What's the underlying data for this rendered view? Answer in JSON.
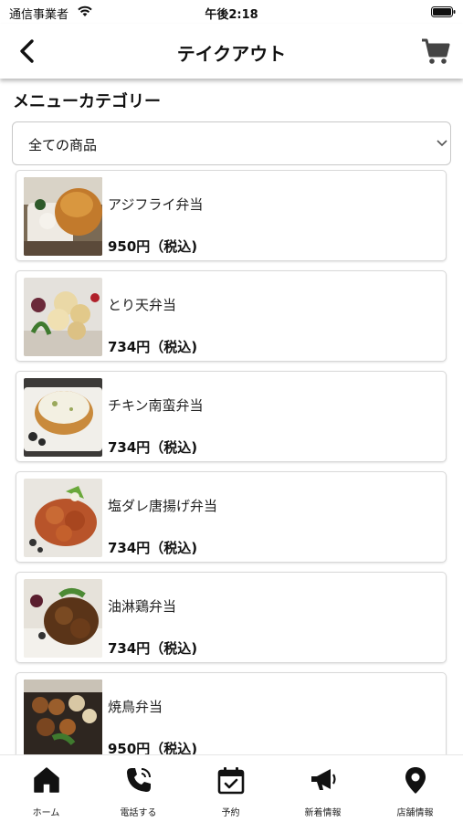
{
  "status_bar": {
    "carrier": "通信事業者",
    "time": "午後2:18"
  },
  "nav": {
    "title": "テイクアウト",
    "back_icon": "chevron-left-icon",
    "cart_icon": "cart-icon"
  },
  "section_title": "メニューカテゴリー",
  "category_select": {
    "value": "全ての商品"
  },
  "menu_items": [
    {
      "name": "アジフライ弁当",
      "price": "950円（税込)"
    },
    {
      "name": "とり天弁当",
      "price": "734円（税込)"
    },
    {
      "name": "チキン南蛮弁当",
      "price": "734円（税込)"
    },
    {
      "name": "塩ダレ唐揚げ弁当",
      "price": "734円（税込)"
    },
    {
      "name": "油淋鶏弁当",
      "price": "734円（税込)"
    },
    {
      "name": "焼鳥弁当",
      "price": "950円（税込)"
    }
  ],
  "tabs": [
    {
      "label": "ホーム",
      "icon": "home-icon"
    },
    {
      "label": "電話する",
      "icon": "phone-icon"
    },
    {
      "label": "予約",
      "icon": "calendar-check-icon"
    },
    {
      "label": "新着情報",
      "icon": "megaphone-icon"
    },
    {
      "label": "店舗情報",
      "icon": "map-pin-icon"
    }
  ]
}
